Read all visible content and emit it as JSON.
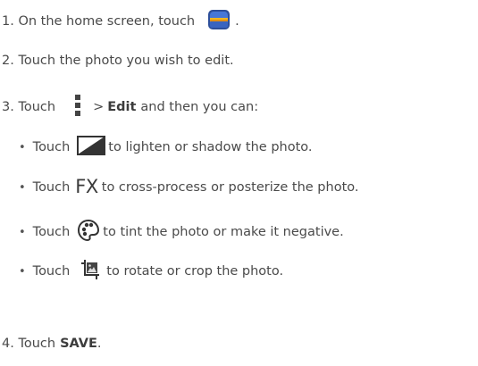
{
  "steps": [
    {
      "prefix": "1. On the home screen, touch",
      "suffix": ".",
      "icon": "gallery-icon"
    },
    {
      "text": "2. Touch the photo you wish to edit."
    },
    {
      "prefix": "3. Touch",
      "bold_arrow": ">",
      "bold": "Edit",
      "suffix": "and then you can:",
      "icon": "menu-vertical-icon"
    },
    {
      "prefix": "4. Touch",
      "bold": "SAVE",
      "suffix": "."
    }
  ],
  "bullets": [
    {
      "prefix": "Touch",
      "suffix": "to lighten or shadow the photo.",
      "icon": "exposure-icon"
    },
    {
      "prefix": "Touch",
      "icon_text": "FX",
      "suffix": "to cross-process or posterize the photo.",
      "icon": "fx-icon"
    },
    {
      "prefix": "Touch",
      "suffix": "to tint the photo or make it negative.",
      "icon": "color-palette-icon"
    },
    {
      "prefix": "Touch",
      "suffix": "to rotate or crop the photo.",
      "icon": "crop-rotate-icon"
    }
  ],
  "bullet_char": "•",
  "colors": {
    "text": "#4a4a4a",
    "gallery_sky": "#3b67c9",
    "gallery_sun": "#f2b21c"
  }
}
